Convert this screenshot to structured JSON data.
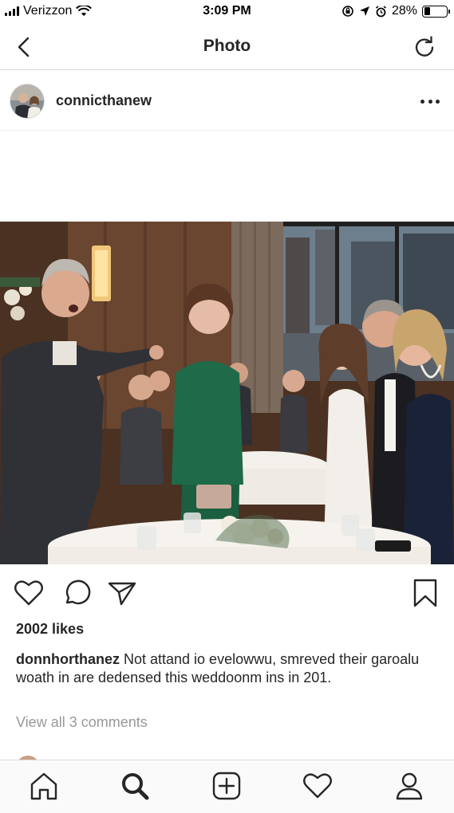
{
  "status_bar": {
    "carrier": "Verizzon",
    "time": "3:09 PM",
    "battery": "28%",
    "battery_level": 0.28
  },
  "nav": {
    "title": "Photo",
    "back_icon": "chevron-left-icon",
    "refresh_icon": "refresh-icon"
  },
  "post": {
    "username": "connicthanew",
    "more_icon": "more-dots-icon"
  },
  "actions": {
    "like_icon": "heart-icon",
    "comment_icon": "comment-icon",
    "share_icon": "send-icon",
    "save_icon": "bookmark-icon"
  },
  "likes": "2002 likes",
  "caption": {
    "username": "donnhorthanez",
    "text": " Not attand io evelowwu, smreved their garoalu woath in are dedensed this weddoonm ins in 201."
  },
  "comments_link": "View all 3 comments",
  "tabbar": {
    "items": [
      "home-icon",
      "search-icon",
      "new-post-icon",
      "activity-icon",
      "profile-icon"
    ]
  },
  "colors": {
    "text": "#262626",
    "muted": "#999999",
    "divider": "#dbdbdb"
  }
}
